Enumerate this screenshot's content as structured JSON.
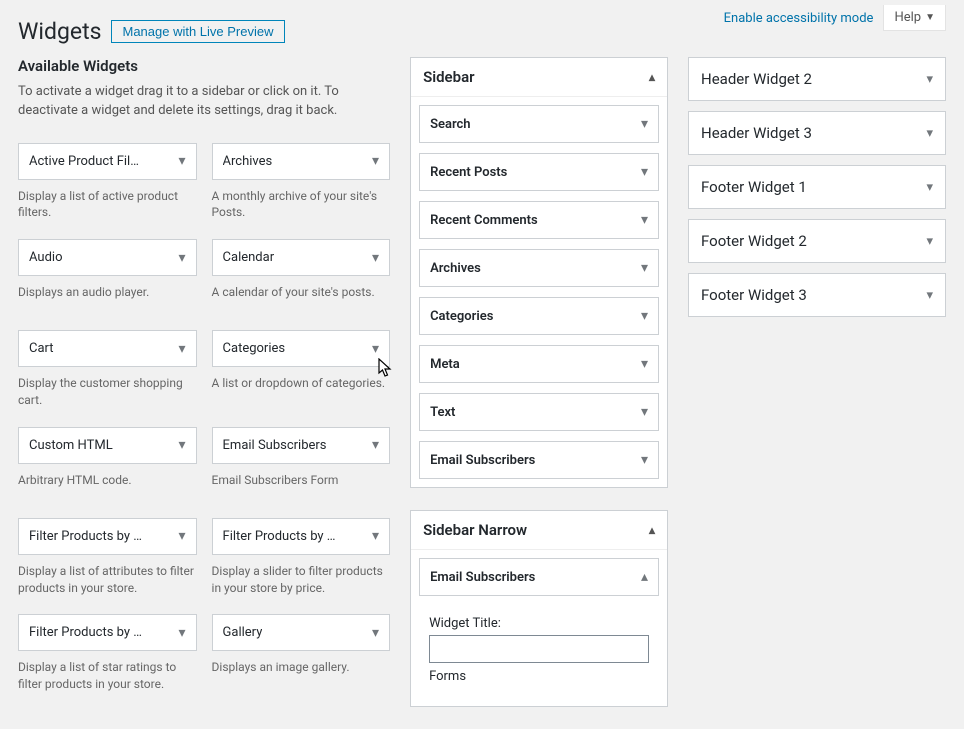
{
  "topbar": {
    "accessibility_link": "Enable accessibility mode",
    "help": "Help"
  },
  "page": {
    "title": "Widgets",
    "preview_button": "Manage with Live Preview"
  },
  "available": {
    "heading": "Available Widgets",
    "description": "To activate a widget drag it to a sidebar or click on it. To deactivate a widget and delete its settings, drag it back.",
    "items": [
      {
        "name": "Active Product Fil…",
        "desc": "Display a list of active product filters."
      },
      {
        "name": "Archives",
        "desc": "A monthly archive of your site's Posts."
      },
      {
        "name": "Audio",
        "desc": "Displays an audio player."
      },
      {
        "name": "Calendar",
        "desc": "A calendar of your site's posts."
      },
      {
        "name": "Cart",
        "desc": "Display the customer shopping cart."
      },
      {
        "name": "Categories",
        "desc": "A list or dropdown of categories."
      },
      {
        "name": "Custom HTML",
        "desc": "Arbitrary HTML code."
      },
      {
        "name": "Email Subscribers",
        "desc": "Email Subscribers Form"
      },
      {
        "name": "Filter Products by …",
        "desc": "Display a list of attributes to filter products in your store."
      },
      {
        "name": "Filter Products by …",
        "desc": "Display a slider to filter products in your store by price."
      },
      {
        "name": "Filter Products by …",
        "desc": "Display a list of star ratings to filter products in your store."
      },
      {
        "name": "Gallery",
        "desc": "Displays an image gallery."
      }
    ]
  },
  "areas_main": [
    {
      "title": "Sidebar",
      "expanded": true,
      "widgets": [
        {
          "name": "Search"
        },
        {
          "name": "Recent Posts"
        },
        {
          "name": "Recent Comments"
        },
        {
          "name": "Archives"
        },
        {
          "name": "Categories"
        },
        {
          "name": "Meta"
        },
        {
          "name": "Text"
        },
        {
          "name": "Email Subscribers"
        }
      ]
    },
    {
      "title": "Sidebar Narrow",
      "expanded": true,
      "open_widget": {
        "name": "Email Subscribers",
        "field1_label": "Widget Title:",
        "field1_value": "",
        "field2_label": "Forms"
      }
    }
  ],
  "areas_right": [
    {
      "title": "Header Widget 2"
    },
    {
      "title": "Header Widget 3"
    },
    {
      "title": "Footer Widget 1"
    },
    {
      "title": "Footer Widget 2"
    },
    {
      "title": "Footer Widget 3"
    }
  ]
}
